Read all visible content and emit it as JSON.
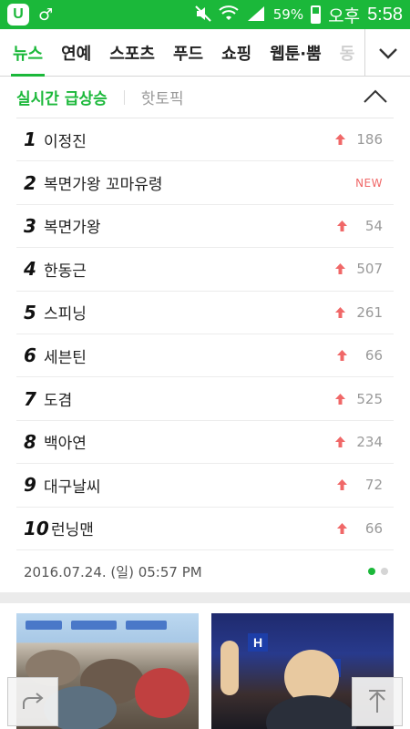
{
  "status_bar": {
    "app_icon_letter": "U",
    "battery_percent": "59%",
    "ampm": "오후",
    "time": "5:58"
  },
  "tabs": [
    {
      "label": "뉴스",
      "active": true
    },
    {
      "label": "연예"
    },
    {
      "label": "스포츠"
    },
    {
      "label": "푸드"
    },
    {
      "label": "쇼핑"
    },
    {
      "label": "웹툰·뿜"
    },
    {
      "label": "동"
    }
  ],
  "keywords": {
    "title": "실시간 급상승",
    "hot_topic_label": "핫토픽",
    "items": [
      {
        "rank": "1",
        "name": "이정진",
        "change": "186"
      },
      {
        "rank": "2",
        "name": "복면가왕 꼬마유령",
        "badge": "NEW"
      },
      {
        "rank": "3",
        "name": "복면가왕",
        "change": "54"
      },
      {
        "rank": "4",
        "name": "한동근",
        "change": "507"
      },
      {
        "rank": "5",
        "name": "스피닝",
        "change": "261"
      },
      {
        "rank": "6",
        "name": "세븐틴",
        "change": "66"
      },
      {
        "rank": "7",
        "name": "도겸",
        "change": "525"
      },
      {
        "rank": "8",
        "name": "백아연",
        "change": "234"
      },
      {
        "rank": "9",
        "name": "대구날씨",
        "change": "72"
      },
      {
        "rank": "10",
        "name": "런닝맨",
        "change": "66"
      }
    ],
    "timestamp": "2016.07.24. (일) 05:57 PM",
    "page_dots": 2,
    "active_dot": 0
  },
  "colors": {
    "brand_green": "#1bb83a",
    "up_arrow": "#f06868"
  },
  "icons": {
    "collapse": "chevron-up-icon",
    "more_tabs": "chevron-down-icon",
    "share": "share-icon",
    "scroll_top": "arrow-up-icon"
  }
}
